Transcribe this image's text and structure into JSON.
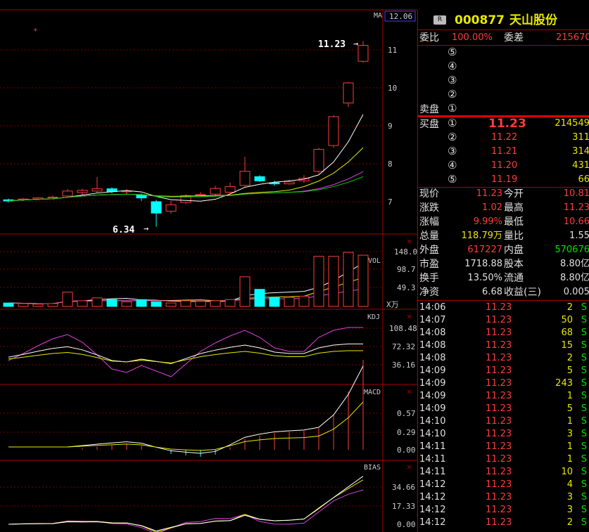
{
  "stock": {
    "badge": "R",
    "code": "000877",
    "name": "天山股份",
    "ma_label": "MA",
    "top_price_box": "12.06"
  },
  "kline": {
    "high_label": "11.23",
    "low_label": "6.34",
    "price_ticks": [
      "11",
      "10",
      "9",
      "8",
      "7"
    ],
    "marker": "*"
  },
  "vol": {
    "label": "VOL",
    "ticks": [
      "148.0",
      "98.7",
      "49.3"
    ],
    "unit": "X万"
  },
  "kdj": {
    "label": "KDJ",
    "ticks": [
      "108.48",
      "72.32",
      "36.16"
    ]
  },
  "macd": {
    "label": "MACD",
    "ticks": [
      "0.57",
      "0.29",
      "0.00"
    ]
  },
  "bias": {
    "label": "BIAS",
    "ticks": [
      "34.66",
      "17.33",
      "0.00"
    ]
  },
  "quote": {
    "weibi_label": "委比",
    "weibi_value": "100.00%",
    "weicha_label": "委差",
    "weicha_value": "215670",
    "sell_label": "卖盘",
    "sell_levels": [
      "⑤",
      "④",
      "③",
      "②",
      "①"
    ],
    "buy_label": "买盘",
    "buy_levels": [
      {
        "idx": "①",
        "price": "11.23",
        "vol": "214549"
      },
      {
        "idx": "②",
        "price": "11.22",
        "vol": "311"
      },
      {
        "idx": "③",
        "price": "11.21",
        "vol": "314"
      },
      {
        "idx": "④",
        "price": "11.20",
        "vol": "431"
      },
      {
        "idx": "⑤",
        "price": "11.19",
        "vol": "66"
      }
    ],
    "stats": [
      {
        "l1": "现价",
        "v1": "11.23",
        "l2": "今开",
        "v2": "10.81"
      },
      {
        "l1": "涨跌",
        "v1": "1.02",
        "l2": "最高",
        "v2": "11.23"
      },
      {
        "l1": "涨幅",
        "v1": "9.99%",
        "l2": "最低",
        "v2": "10.66"
      },
      {
        "l1": "总量",
        "v1": "118.79万",
        "l2": "量比",
        "v2": "1.55"
      },
      {
        "l1": "外盘",
        "v1": "617227",
        "l2": "内盘",
        "v2": "570676"
      },
      {
        "l1": "市盈",
        "v1": "1718.88",
        "l2": "股本",
        "v2": "8.80亿"
      },
      {
        "l1": "换手",
        "v1": "13.50%",
        "l2": "流通",
        "v2": "8.80亿"
      },
      {
        "l1": "净资",
        "v1": "6.68",
        "l2": "收益(三)",
        "v2": "0.005"
      }
    ]
  },
  "ticks": [
    {
      "time": "14:06",
      "price": "11.23",
      "vol": "2",
      "side": "S"
    },
    {
      "time": "14:07",
      "price": "11.23",
      "vol": "50",
      "side": "S"
    },
    {
      "time": "14:08",
      "price": "11.23",
      "vol": "68",
      "side": "S"
    },
    {
      "time": "14:08",
      "price": "11.23",
      "vol": "15",
      "side": "S"
    },
    {
      "time": "14:08",
      "price": "11.23",
      "vol": "2",
      "side": "S"
    },
    {
      "time": "14:09",
      "price": "11.23",
      "vol": "5",
      "side": "S"
    },
    {
      "time": "14:09",
      "price": "11.23",
      "vol": "243",
      "side": "S"
    },
    {
      "time": "14:09",
      "price": "11.23",
      "vol": "1",
      "side": "S"
    },
    {
      "time": "14:09",
      "price": "11.23",
      "vol": "5",
      "side": "S"
    },
    {
      "time": "14:10",
      "price": "11.23",
      "vol": "1",
      "side": "S"
    },
    {
      "time": "14:10",
      "price": "11.23",
      "vol": "3",
      "side": "S"
    },
    {
      "time": "14:11",
      "price": "11.23",
      "vol": "1",
      "side": "S"
    },
    {
      "time": "14:11",
      "price": "11.23",
      "vol": "1",
      "side": "S"
    },
    {
      "time": "14:11",
      "price": "11.23",
      "vol": "10",
      "side": "S"
    },
    {
      "time": "14:12",
      "price": "11.23",
      "vol": "4",
      "side": "S"
    },
    {
      "time": "14:12",
      "price": "11.23",
      "vol": "3",
      "side": "S"
    },
    {
      "time": "14:12",
      "price": "11.23",
      "vol": "3",
      "side": "S"
    },
    {
      "time": "14:12",
      "price": "11.23",
      "vol": "2",
      "side": "S"
    }
  ],
  "chart_data": {
    "type": "candlestick",
    "candles": [
      {
        "o": 7.05,
        "c": 7.02,
        "h": 7.08,
        "l": 6.98
      },
      {
        "o": 7.05,
        "c": 7.07,
        "h": 7.1,
        "l": 7.02
      },
      {
        "o": 7.07,
        "c": 7.1,
        "h": 7.12,
        "l": 7.04
      },
      {
        "o": 7.1,
        "c": 7.12,
        "h": 7.16,
        "l": 7.06
      },
      {
        "o": 7.15,
        "c": 7.28,
        "h": 7.33,
        "l": 7.12
      },
      {
        "o": 7.24,
        "c": 7.3,
        "h": 7.34,
        "l": 7.18
      },
      {
        "o": 7.28,
        "c": 7.34,
        "h": 7.65,
        "l": 7.22
      },
      {
        "o": 7.34,
        "c": 7.27,
        "h": 7.38,
        "l": 7.22
      },
      {
        "o": 7.27,
        "c": 7.28,
        "h": 7.33,
        "l": 7.2
      },
      {
        "o": 7.18,
        "c": 7.1,
        "h": 7.22,
        "l": 7.02
      },
      {
        "o": 7.0,
        "c": 6.7,
        "h": 7.05,
        "l": 6.34
      },
      {
        "o": 6.75,
        "c": 6.92,
        "h": 7.02,
        "l": 6.68
      },
      {
        "o": 6.98,
        "c": 7.16,
        "h": 7.2,
        "l": 6.94
      },
      {
        "o": 7.17,
        "c": 7.19,
        "h": 7.25,
        "l": 7.15
      },
      {
        "o": 7.2,
        "c": 7.35,
        "h": 7.42,
        "l": 7.15
      },
      {
        "o": 7.25,
        "c": 7.4,
        "h": 7.5,
        "l": 7.22
      },
      {
        "o": 7.43,
        "c": 7.8,
        "h": 8.18,
        "l": 7.4
      },
      {
        "o": 7.66,
        "c": 7.55,
        "h": 7.7,
        "l": 7.52
      },
      {
        "o": 7.5,
        "c": 7.47,
        "h": 7.55,
        "l": 7.42
      },
      {
        "o": 7.47,
        "c": 7.52,
        "h": 7.58,
        "l": 7.45
      },
      {
        "o": 7.55,
        "c": 7.62,
        "h": 7.7,
        "l": 7.5
      },
      {
        "o": 7.8,
        "c": 8.38,
        "h": 8.42,
        "l": 7.75
      },
      {
        "o": 8.48,
        "c": 9.24,
        "h": 9.28,
        "l": 8.42
      },
      {
        "o": 9.6,
        "c": 10.13,
        "h": 10.16,
        "l": 9.5
      },
      {
        "o": 10.7,
        "c": 11.12,
        "h": 11.23,
        "l": 10.66
      }
    ],
    "volume": [
      6,
      5,
      4,
      5,
      25,
      10,
      15,
      12,
      8,
      12,
      8,
      6,
      10,
      9,
      10,
      12,
      52,
      30,
      16,
      16,
      18,
      88,
      88,
      95,
      90
    ]
  }
}
